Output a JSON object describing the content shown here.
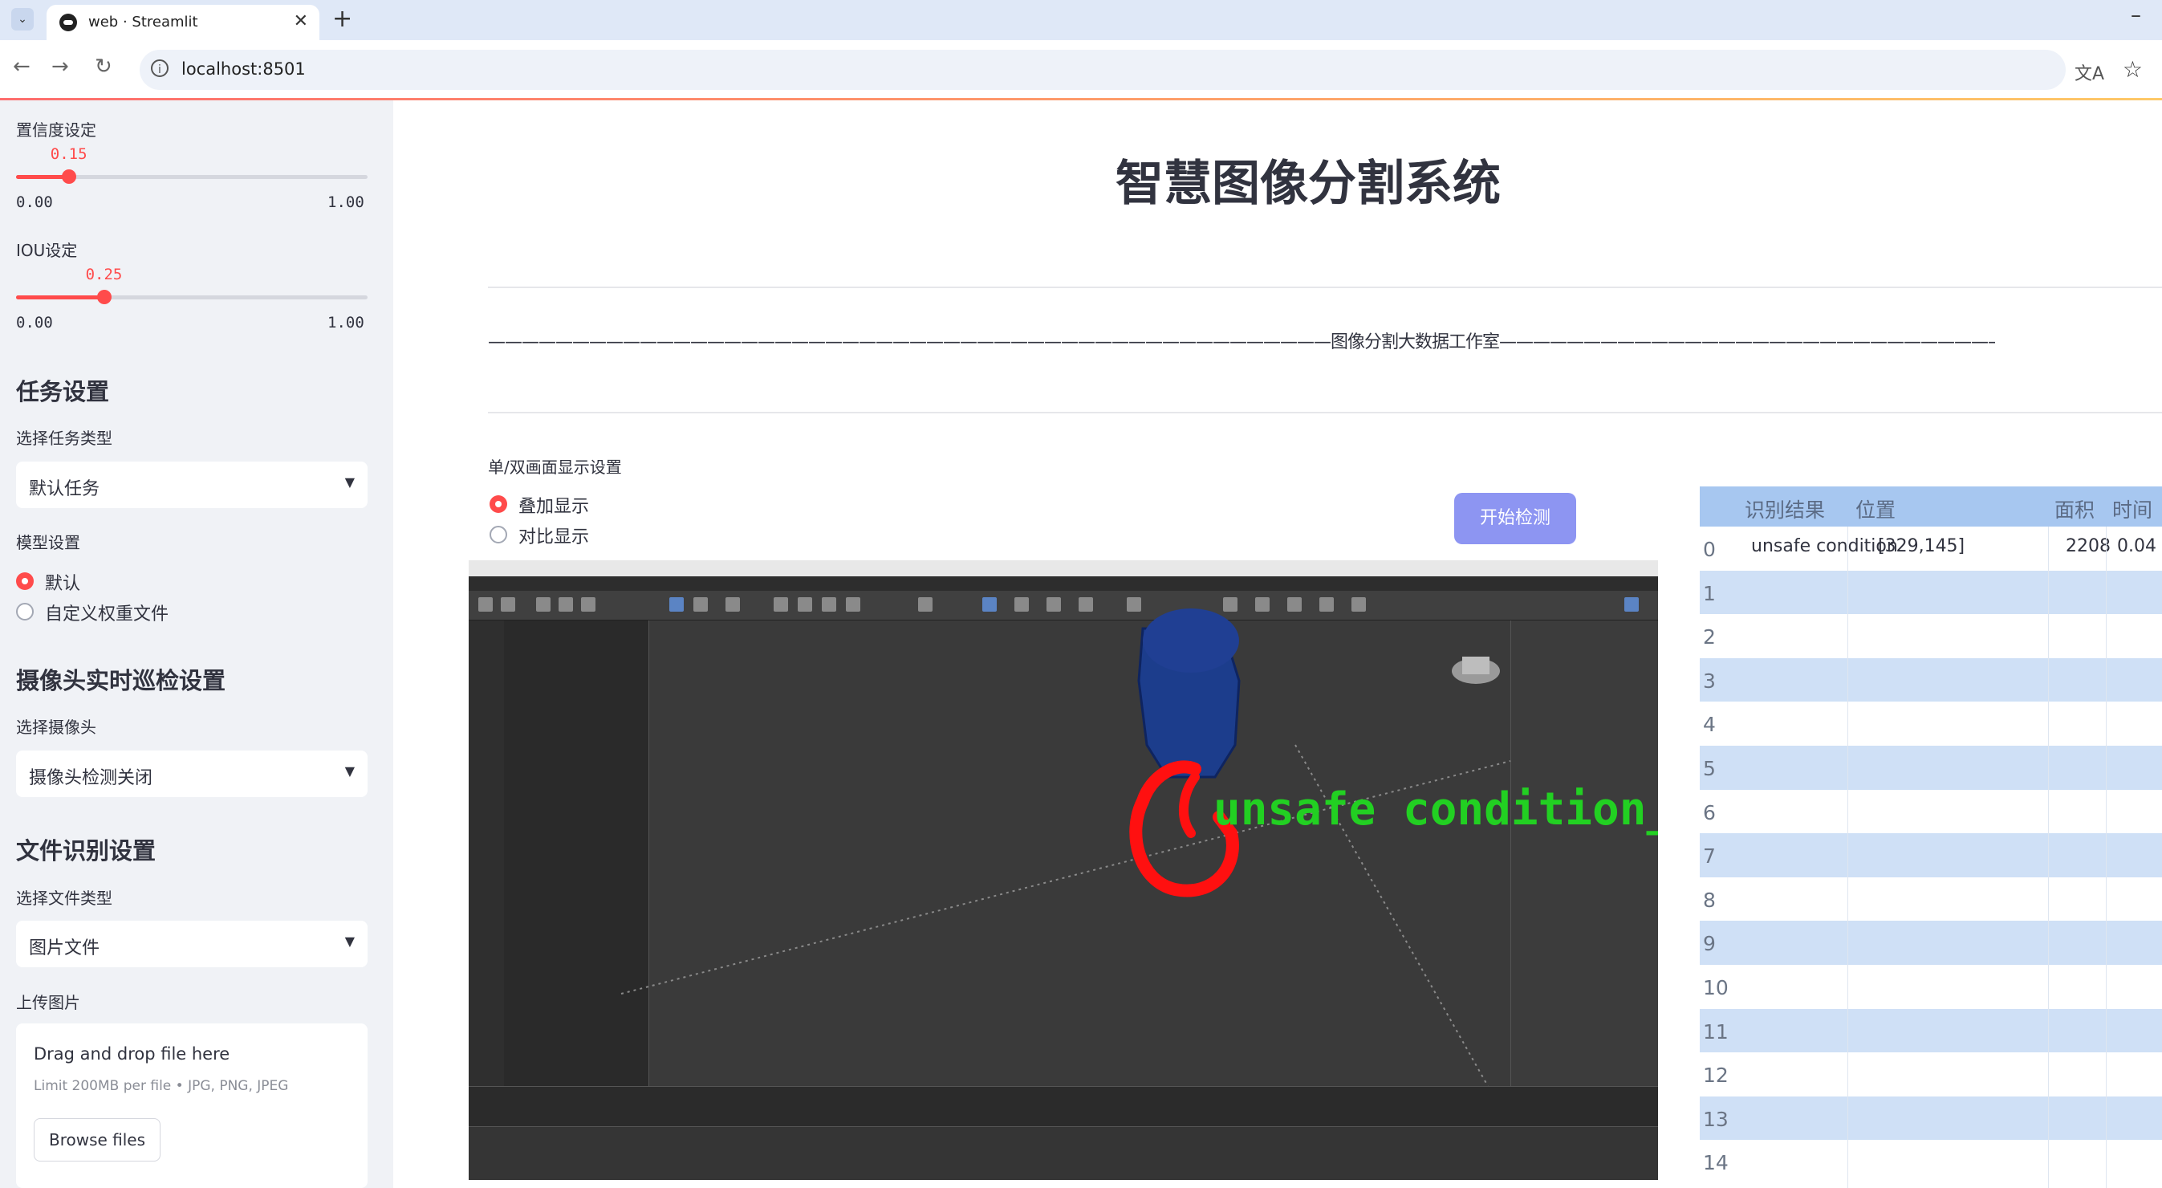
{
  "browser": {
    "tab_title": "web · Streamlit",
    "url": "localhost:8501",
    "tab_close_glyph": "✕",
    "new_tab_glyph": "+",
    "minimize_glyph": "–"
  },
  "sidebar": {
    "confidence": {
      "label": "置信度设定",
      "value_text": "0.15",
      "value": 0.15,
      "min_text": "0.00",
      "max_text": "1.00"
    },
    "iou": {
      "label": "IOU设定",
      "value_text": "0.25",
      "value": 0.25,
      "min_text": "0.00",
      "max_text": "1.00"
    },
    "task_section": {
      "heading": "任务设置",
      "select_label": "选择任务类型",
      "selected": "默认任务"
    },
    "model_section": {
      "label": "模型设置",
      "options": [
        "默认",
        "自定义权重文件"
      ],
      "selected_index": 0
    },
    "camera_section": {
      "heading": "摄像头实时巡检设置",
      "select_label": "选择摄像头",
      "selected": "摄像头检测关闭"
    },
    "file_section": {
      "heading": "文件识别设置",
      "select_label": "选择文件类型",
      "selected": "图片文件"
    },
    "upload": {
      "label": "上传图片",
      "drop_text": "Drag and drop file here",
      "limit_text": "Limit 200MB per file • JPG, PNG, JPEG",
      "browse_label": "Browse files"
    }
  },
  "main": {
    "title": "智慧图像分割系统",
    "banner_text": "图像分割大数据工作室",
    "display_mode": {
      "label": "单/双画面显示设置",
      "options": [
        "叠加显示",
        "对比显示"
      ],
      "selected_index": 0
    },
    "start_button": "开始检测",
    "detection_label": "unsafe condition_"
  },
  "results_table": {
    "columns": [
      "识别结果",
      "位置",
      "面积",
      "时间"
    ],
    "rows": [
      {
        "index": "0",
        "result": "unsafe condition",
        "position": "[329,145]",
        "area": "2208",
        "time": "0.04"
      },
      {
        "index": "1",
        "result": "",
        "position": "",
        "area": "",
        "time": ""
      },
      {
        "index": "2",
        "result": "",
        "position": "",
        "area": "",
        "time": ""
      },
      {
        "index": "3",
        "result": "",
        "position": "",
        "area": "",
        "time": ""
      },
      {
        "index": "4",
        "result": "",
        "position": "",
        "area": "",
        "time": ""
      },
      {
        "index": "5",
        "result": "",
        "position": "",
        "area": "",
        "time": ""
      },
      {
        "index": "6",
        "result": "",
        "position": "",
        "area": "",
        "time": ""
      },
      {
        "index": "7",
        "result": "",
        "position": "",
        "area": "",
        "time": ""
      },
      {
        "index": "8",
        "result": "",
        "position": "",
        "area": "",
        "time": ""
      },
      {
        "index": "9",
        "result": "",
        "position": "",
        "area": "",
        "time": ""
      },
      {
        "index": "10",
        "result": "",
        "position": "",
        "area": "",
        "time": ""
      },
      {
        "index": "11",
        "result": "",
        "position": "",
        "area": "",
        "time": ""
      },
      {
        "index": "12",
        "result": "",
        "position": "",
        "area": "",
        "time": ""
      },
      {
        "index": "13",
        "result": "",
        "position": "",
        "area": "",
        "time": ""
      },
      {
        "index": "14",
        "result": "",
        "position": "",
        "area": "",
        "time": ""
      }
    ]
  },
  "colors": {
    "accent": "#ff4b4b",
    "sidebar_bg": "#f0f2f6",
    "button": "#8d95f2",
    "table_header": "#a7c7f0",
    "table_stripe": "#cfe0f6",
    "segmentation_mask": "#ff1010",
    "label_text": "#22d022"
  }
}
